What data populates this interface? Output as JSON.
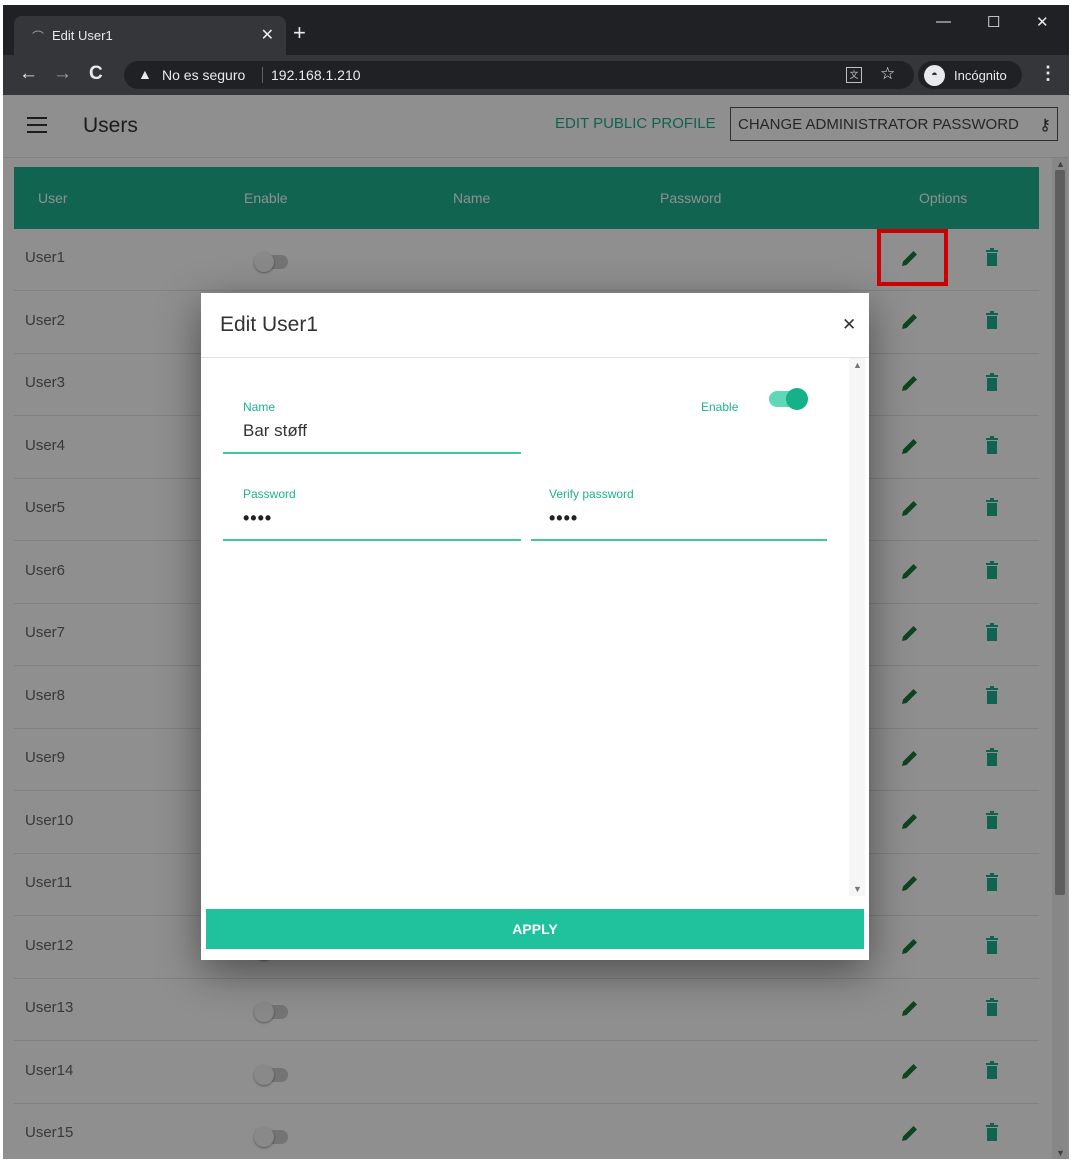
{
  "browser": {
    "tab_title": "Edit User1",
    "security_label": "No es seguro",
    "url": "192.168.1.210",
    "incognito_label": "Incógnito"
  },
  "app": {
    "title": "Users",
    "edit_public_profile": "EDIT PUBLIC PROFILE",
    "change_admin_password": "CHANGE ADMINISTRATOR PASSWORD"
  },
  "table": {
    "headers": [
      "User",
      "Enable",
      "Name",
      "Password",
      "Options"
    ],
    "rows": [
      {
        "user": "User1"
      },
      {
        "user": "User2"
      },
      {
        "user": "User3"
      },
      {
        "user": "User4"
      },
      {
        "user": "User5"
      },
      {
        "user": "User6"
      },
      {
        "user": "User7"
      },
      {
        "user": "User8"
      },
      {
        "user": "User9"
      },
      {
        "user": "User10"
      },
      {
        "user": "User11"
      },
      {
        "user": "User12"
      },
      {
        "user": "User13"
      },
      {
        "user": "User14"
      },
      {
        "user": "User15"
      }
    ]
  },
  "dialog": {
    "title": "Edit User1",
    "name_label": "Name",
    "name_value": "Bar støff",
    "enable_label": "Enable",
    "enable_on": true,
    "password_label": "Password",
    "password_value": "••••",
    "verify_label": "Verify password",
    "verify_value": "••••",
    "apply_label": "APPLY"
  },
  "colors": {
    "accent": "#1fb58f",
    "highlight": "#cc0000"
  }
}
